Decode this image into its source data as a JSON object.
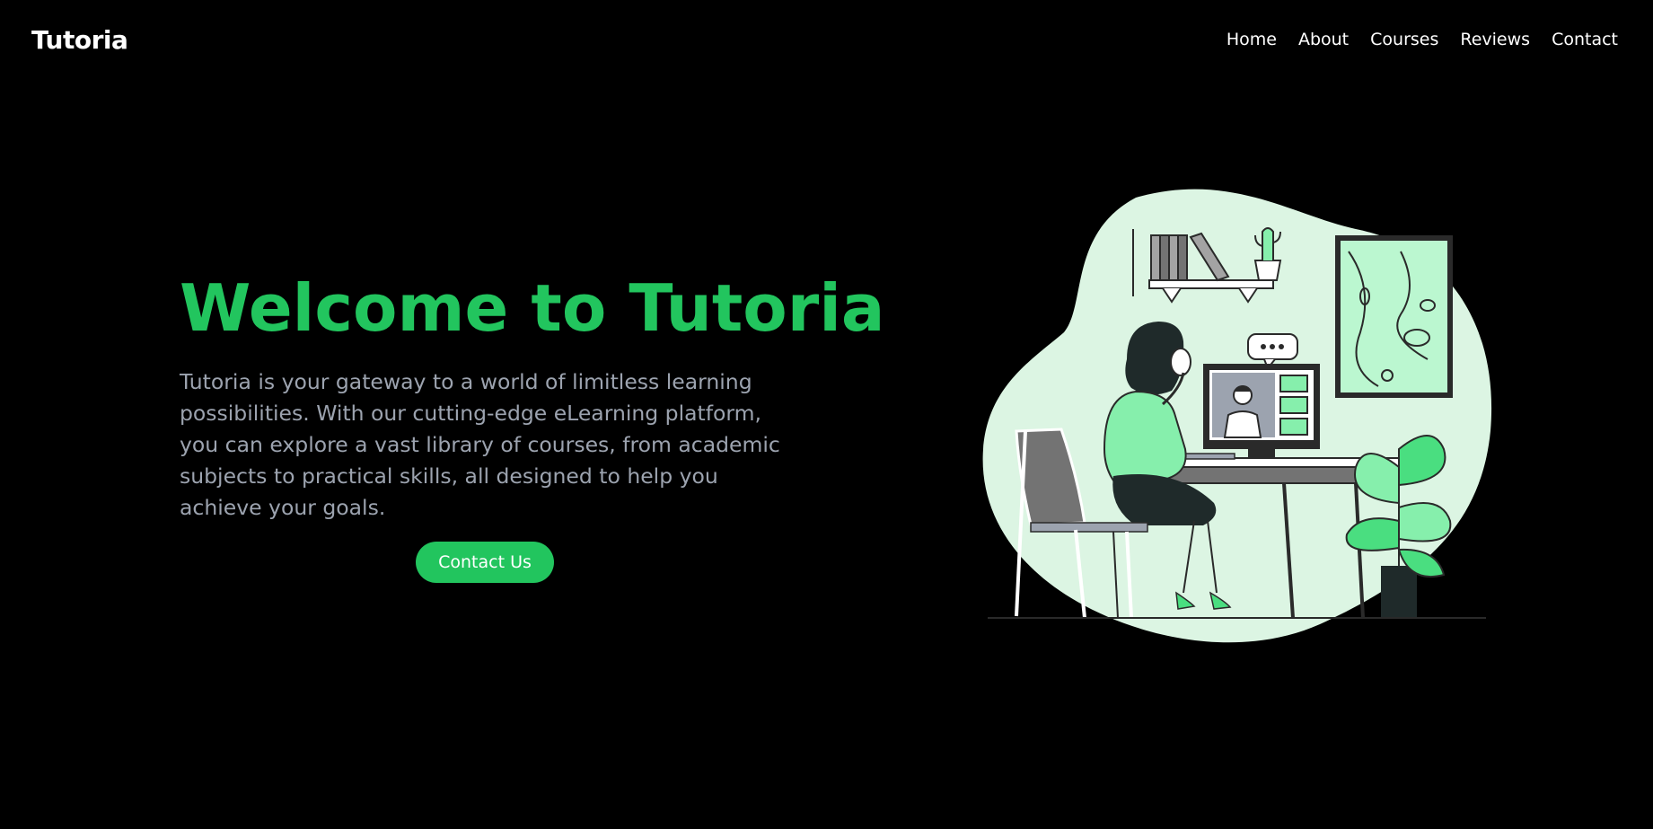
{
  "brand": {
    "name": "Tutoria"
  },
  "nav": {
    "items": [
      {
        "label": "Home"
      },
      {
        "label": "About"
      },
      {
        "label": "Courses"
      },
      {
        "label": "Reviews"
      },
      {
        "label": "Contact"
      }
    ]
  },
  "hero": {
    "title": "Welcome to Tutoria",
    "description": "Tutoria is your gateway to a world of limitless learning possibilities. With our cutting-edge eLearning platform, you can explore a vast library of courses, from academic subjects to practical skills, all designed to help you achieve your goals.",
    "cta_label": "Contact Us"
  },
  "colors": {
    "background": "#000000",
    "accent": "#22c55e",
    "text_muted": "#9ca3af",
    "blob": "#dcf5e3"
  },
  "icons": {
    "illustration": "woman-online-learning-illustration"
  }
}
